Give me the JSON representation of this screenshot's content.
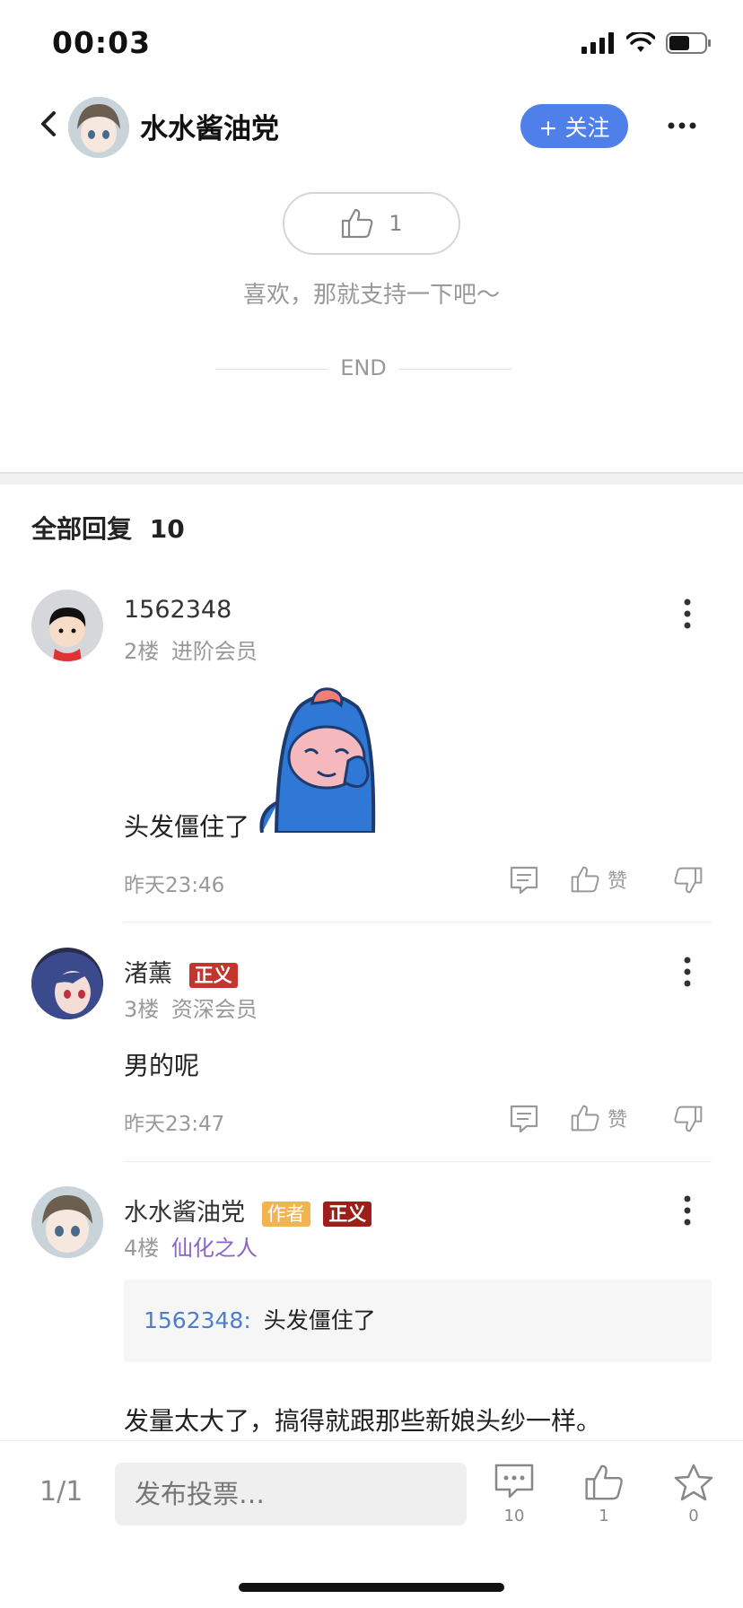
{
  "status_bar": {
    "time": "00:03"
  },
  "header": {
    "name": "水水酱油党",
    "follow_label": "+ 关注"
  },
  "like": {
    "count": "1",
    "support_text": "喜欢，那就支持一下吧～",
    "end_text": "END"
  },
  "replies": {
    "title": "全部回复",
    "count": "10"
  },
  "comments": [
    {
      "name": "1562348",
      "floor": "2楼",
      "rank": "进阶会员",
      "text": "头发僵住了",
      "time": "昨天23:46",
      "like_label": "赞"
    },
    {
      "name": "渚薰",
      "badge": "正义",
      "floor": "3楼",
      "rank": "资深会员",
      "text": "男的呢",
      "time": "昨天23:47",
      "like_label": "赞"
    },
    {
      "name": "水水酱油党",
      "author_badge": "作者",
      "badge": "正义",
      "floor": "4楼",
      "rank": "仙化之人",
      "quote_user": "1562348:",
      "quote_text": "头发僵住了",
      "text": "发量太大了，搞得就跟那些新娘头纱一样。"
    }
  ],
  "bottom_bar": {
    "page": "1/1",
    "input_placeholder": "发布投票…",
    "comment_count": "10",
    "like_count": "1",
    "star_count": "0"
  },
  "colors": {
    "accent": "#4f80ea",
    "badge_red": "#c2362f",
    "author_badge": "#f1b450",
    "rank_purple": "#8a63c9",
    "quote_blue": "#4a7fd0"
  }
}
